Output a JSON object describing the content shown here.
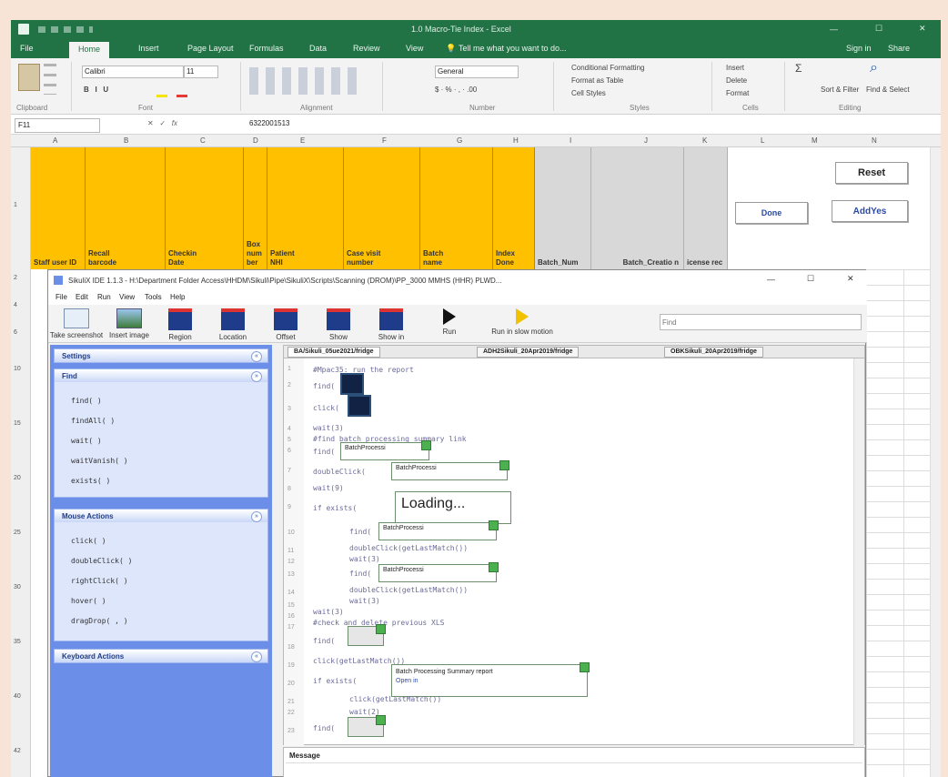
{
  "excel": {
    "title": "1.0 Macro-Tie Index - Excel",
    "tabs": [
      "File",
      "Home",
      "Insert",
      "Page Layout",
      "Formulas",
      "Data",
      "Review",
      "View"
    ],
    "tell_me": "Tell me what you want to do...",
    "sign_in": "Sign in",
    "share": "Share",
    "ribbon": {
      "font_name": "Calibri",
      "font_size": "11",
      "number_format": "General",
      "conditional": "Conditional Formatting",
      "format_table": "Format as Table",
      "cell_styles": "Cell Styles",
      "insert": "Insert",
      "delete": "Delete",
      "format": "Format",
      "sort_filter": "Sort & Filter",
      "find_select": "Find & Select",
      "groups": [
        "Clipboard",
        "Font",
        "Alignment",
        "Number",
        "Styles",
        "Cells",
        "Editing"
      ]
    },
    "name_box": "F11",
    "formula": "6322001513",
    "columns": [
      "A",
      "B",
      "C",
      "D",
      "E",
      "F",
      "G",
      "H",
      "I",
      "J",
      "K",
      "L",
      "M",
      "N"
    ],
    "headers": [
      "Staff user ID",
      "Recall barcode",
      "Checkin Date",
      "Box num ber",
      "Patient NHI",
      "Case visit number",
      "Batch name",
      "Index Done",
      "Batch_Num",
      "Batch_Creatio n",
      "icense rec"
    ],
    "buttons": {
      "reset": "Reset",
      "done": "Done",
      "add_yes": "AddYes"
    }
  },
  "ide": {
    "title": "SikuliX IDE 1.1.3 - H:\\Department Folder Access\\HHDM\\Sikuli\\Pipe\\SikuliX\\Scripts\\Scanning (DROM)\\PP_3000 MMHS (HHR) PLWD...",
    "menu": [
      "File",
      "Edit",
      "Run",
      "View",
      "Tools",
      "Help"
    ],
    "toolbar": [
      "Take screenshot",
      "Insert image",
      "Region",
      "Location",
      "Offset",
      "Show",
      "Show in",
      "Run",
      "Run in slow motion"
    ],
    "find_placeholder": "Find",
    "tabs": [
      "BA/Sikuli_05ue2021/fridge",
      "ADH2Sikuli_20Apr2019/fridge",
      "OBKSikuli_20Apr2019/fridge"
    ],
    "panels": {
      "settings": "Settings",
      "find": "Find",
      "find_items": [
        "find( )",
        "findAll( )",
        "wait( )",
        "waitVanish( )",
        "exists( )"
      ],
      "mouse": "Mouse Actions",
      "mouse_items": [
        "click( )",
        "doubleClick( )",
        "rightClick( )",
        "hover( )",
        "dragDrop( , )"
      ],
      "keyboard": "Keyboard Actions"
    },
    "code": [
      "#Mpac35: run the report",
      "find(",
      "click(",
      "wait(3)",
      "#find batch processing summary link",
      "find(",
      "doubleClick(",
      "wait(9)",
      "if exists(",
      "find(",
      "doubleClick(getLastMatch())",
      "wait(3)",
      "find(",
      "doubleClick(getLastMatch())",
      "wait(3)",
      "wait(3)",
      "#check and delete previous XLS",
      "find(",
      "click(getLastMatch())",
      "if exists(",
      "click(getLastMatch())",
      "wait(2)",
      "find("
    ],
    "thumbs": {
      "batch1": "BatchProcessi",
      "batch2": "BatchProcessi",
      "loading": "Loading...",
      "batch3": "BatchProcessi",
      "batch4": "BatchProcessi",
      "summary": "Batch Processing Summary report",
      "open": "Open in"
    },
    "message": "Message"
  }
}
